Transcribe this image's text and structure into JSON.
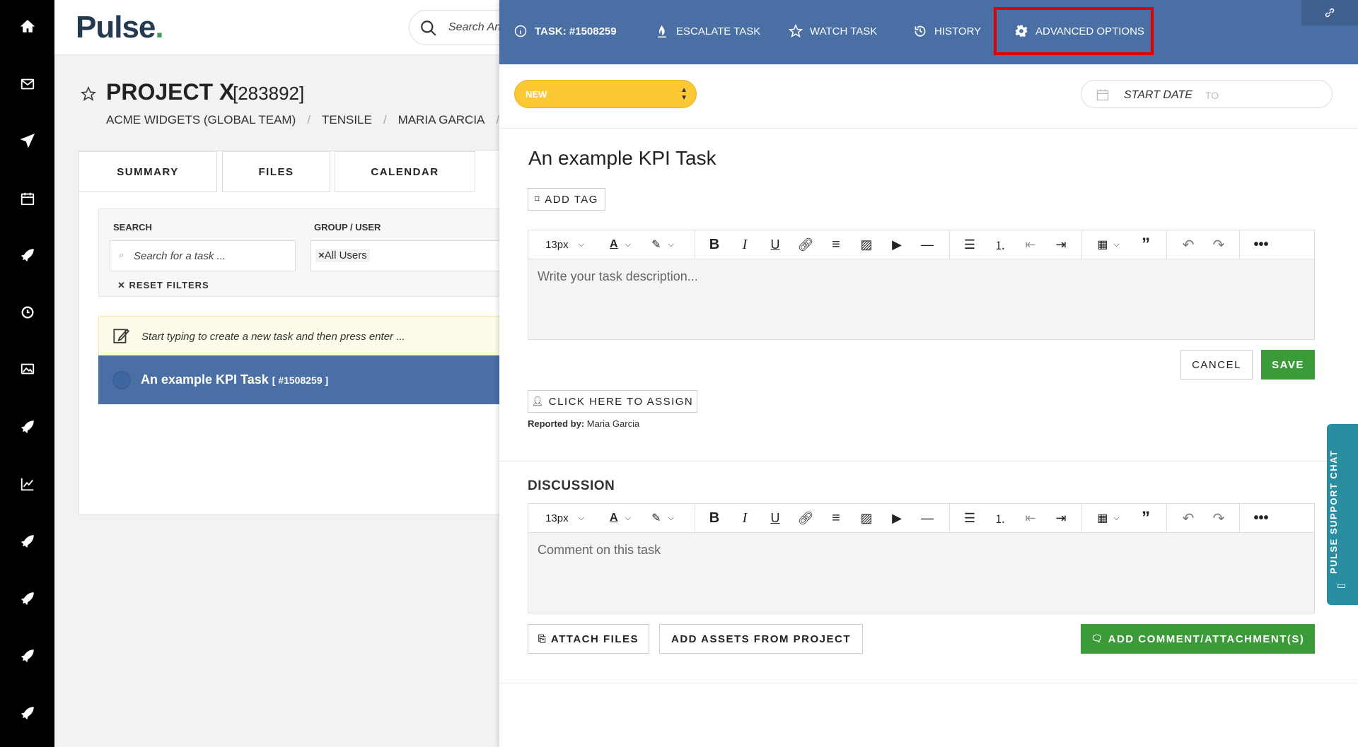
{
  "app": {
    "logo": "Pulse",
    "logo_dot": "."
  },
  "search": {
    "placeholder": "Search Any"
  },
  "project": {
    "title": "PROJECT X",
    "id": "[283892]",
    "breadcrumb": [
      "ACME WIDGETS (GLOBAL TEAM)",
      "TENSILE",
      "MARIA GARCIA"
    ]
  },
  "tabs": [
    "SUMMARY",
    "FILES",
    "CALENDAR"
  ],
  "filters": {
    "search_label": "SEARCH",
    "search_placeholder": "Search for a task ...",
    "group_label": "GROUP / USER",
    "group_value": "All Users",
    "reset_label": "RESET FILTERS"
  },
  "task_list": {
    "hint": "Start typing to create a new task and then press enter ...",
    "row_title": "An example KPI Task",
    "row_id": "[ #1508259 ]"
  },
  "drawer": {
    "header": {
      "task_label": "TASK: #1508259",
      "escalate": "ESCALATE TASK",
      "watch": "WATCH TASK",
      "history": "HISTORY",
      "advanced": "ADVANCED OPTIONS"
    },
    "status": "NEW",
    "start_date": "START DATE",
    "to": "TO",
    "title": "An example KPI Task",
    "add_tag": "ADD TAG",
    "font_size": "13px",
    "description_placeholder": "Write your task description...",
    "cancel": "CANCEL",
    "save": "SAVE",
    "assign": "CLICK HERE TO ASSIGN",
    "reported_label": "Reported by:",
    "reported_by": "Maria Garcia",
    "discussion_heading": "DISCUSSION",
    "comment_placeholder": "Comment on this task",
    "attach_files": "ATTACH FILES",
    "add_assets": "ADD ASSETS FROM PROJECT",
    "add_comment": "ADD COMMENT/ATTACHMENT(S)"
  },
  "support_chat": "PULSE SUPPORT CHAT",
  "colors": {
    "header_blue": "#4a6fa5",
    "status_yellow": "#fcc833",
    "save_green": "#3c9b39",
    "highlight_red": "#e00000",
    "support_teal": "#2a8ea0"
  }
}
